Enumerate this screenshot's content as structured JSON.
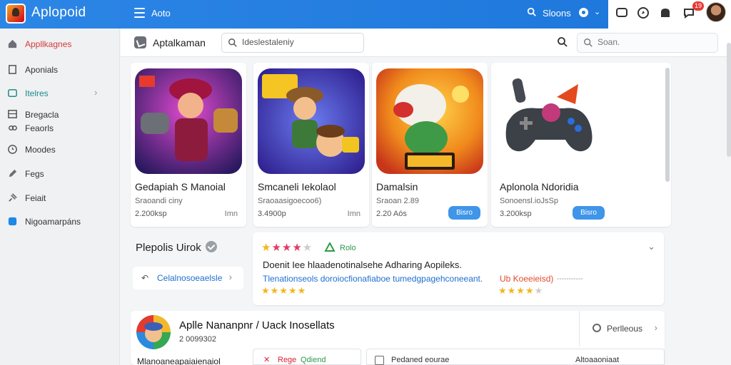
{
  "app": {
    "title": "Aplopoid",
    "nav_label": "Aoto",
    "search_label": "Sloons"
  },
  "notifications": {
    "badge": "19"
  },
  "sidebar": {
    "items": [
      {
        "label": "Appllkagnes",
        "icon": "home-icon",
        "color": "#d23a3a"
      },
      {
        "label": "Aponials",
        "icon": "bookmark-icon",
        "color": "#333333"
      },
      {
        "label": "Itelres",
        "icon": "apps-icon",
        "color": "#1f8a8a"
      },
      {
        "label": "Bregacla",
        "icon": "grid-icon",
        "color": "#333333"
      },
      {
        "label": "Feaorls",
        "icon": "link-icon",
        "color": "#333333"
      },
      {
        "label": "Moodes",
        "icon": "clock-icon",
        "color": "#333333"
      },
      {
        "label": "Fegs",
        "icon": "pen-icon",
        "color": "#333333"
      },
      {
        "label": "Feiait",
        "icon": "pin-icon",
        "color": "#333333"
      },
      {
        "label": "Nigoamarpáns",
        "icon": "calendar-icon",
        "color": "#333333"
      }
    ]
  },
  "subheader": {
    "title": "Aptalkaman",
    "search_value": "Ideslestaleniy",
    "search2_placeholder": "Soan."
  },
  "cards": [
    {
      "title": "Gedapiah S Manoial",
      "subtitle": "Sraoandi ciny",
      "count": "2.200ksp",
      "meta": "Imn",
      "button": ""
    },
    {
      "title": "Smcaneli Iekolaol",
      "subtitle": "Sraoaasigoecoo6)",
      "count": "3.4900p",
      "meta": "Imn",
      "button": ""
    },
    {
      "title": "Damalsin",
      "subtitle": "Sraoan 2.89",
      "count": "2.20 Aós",
      "meta": "",
      "button": "Bisro"
    },
    {
      "title": "Aplonola Ndoridia",
      "subtitle": "Sonoensl.ioJsSp",
      "count": "3.200ksp",
      "meta": "",
      "button": "Bisro"
    }
  ],
  "featured": {
    "title": "Plepolis Uirok",
    "link": "Celalnosoeaelsle"
  },
  "rating": {
    "tag": "Rolo",
    "description": "Doenit Iee hlaadenotinalsehe Adharing Aopileks.",
    "link_text": "Tlenationseols doroiocfionafiaboe tumedgpagehconeeant.",
    "link2_text": "Ub Koeeieisd)",
    "note": "-----------"
  },
  "developer": {
    "name": "Aplle Nananpnr / Uack Inosellats",
    "subtitle": "2 0099302",
    "action": "Perlleous"
  },
  "bottom": {
    "left_text": "Mlanoaneapaiaienaiol",
    "btn1_a": "Rege",
    "btn1_b": "Qdiend",
    "btn2_label": "Pedaned eourae",
    "btn2_right": "Altoaaoniaat"
  }
}
